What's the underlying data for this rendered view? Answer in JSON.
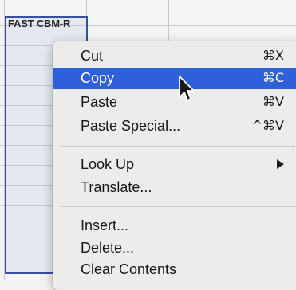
{
  "sheet": {
    "cell_label": "FAST CBM-R"
  },
  "menu": {
    "items": [
      {
        "label": "Cut",
        "shortcut": "⌘X"
      },
      {
        "label": "Copy",
        "shortcut": "⌘C"
      },
      {
        "label": "Paste",
        "shortcut": "⌘V"
      },
      {
        "label": "Paste Special...",
        "shortcut": "^⌘V"
      },
      {
        "label": "Look Up",
        "submenu_icon": "submenu-arrow-icon"
      },
      {
        "label": "Translate..."
      },
      {
        "label": "Insert..."
      },
      {
        "label": "Delete..."
      },
      {
        "label": "Clear Contents"
      }
    ],
    "highlighted": "Copy",
    "highlight_color": "#2f5fd9"
  },
  "icons": {
    "cursor": "mouse-pointer-icon"
  }
}
